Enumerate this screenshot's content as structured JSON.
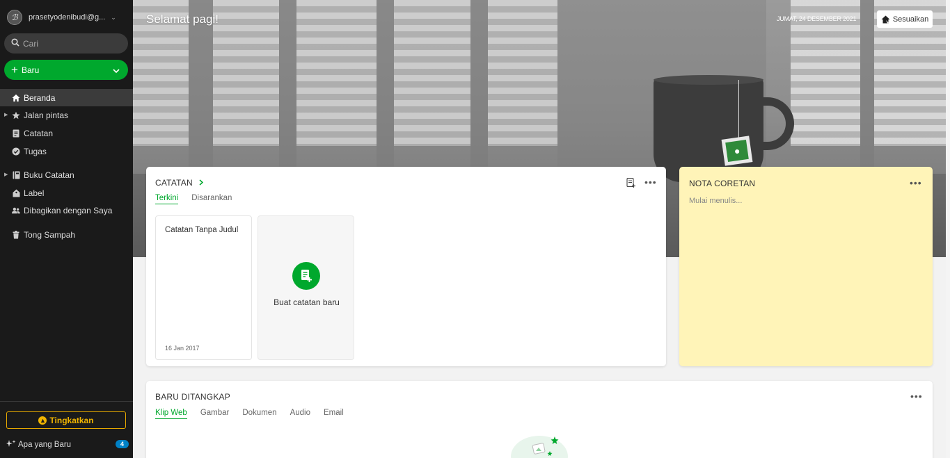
{
  "account": {
    "email": "prasetyodenibudi@g...",
    "avatar_letter": "ℬ"
  },
  "search": {
    "placeholder": "Cari"
  },
  "new_button": {
    "label": "Baru"
  },
  "nav": {
    "home": "Beranda",
    "shortcuts": "Jalan pintas",
    "notes": "Catatan",
    "tasks": "Tugas",
    "notebooks": "Buku Catatan",
    "tags": "Label",
    "shared": "Dibagikan dengan Saya",
    "trash": "Tong Sampah"
  },
  "upgrade": {
    "label": "Tingkatkan"
  },
  "whats_new": {
    "label": "Apa yang Baru",
    "count": "4"
  },
  "hero": {
    "greeting": "Selamat pagi!",
    "date": "JUMAT, 24 DESEMBER 2021",
    "customize_label": "Sesuaikan"
  },
  "notes_widget": {
    "title": "CATATAN",
    "tabs": [
      "Terkini",
      "Disarankan"
    ],
    "items": [
      {
        "title": "Catatan Tanpa Judul",
        "date": "16 Jan 2017"
      }
    ],
    "new_note_label": "Buat catatan baru"
  },
  "scratch_pad": {
    "title": "NOTA CORETAN",
    "placeholder": "Mulai menulis..."
  },
  "captured_widget": {
    "title": "BARU DITANGKAP",
    "tabs": [
      "Klip Web",
      "Gambar",
      "Dokumen",
      "Audio",
      "Email"
    ]
  },
  "colors": {
    "accent_green": "#00a82d",
    "sidebar_bg": "#1a1a1a",
    "upgrade_gold": "#f0b400",
    "badge_blue": "#0081c6",
    "scratch_yellow": "#fff4b8"
  },
  "icons": [
    "chevron-down-icon",
    "search-icon",
    "plus-icon",
    "home-icon",
    "star-icon",
    "note-icon",
    "check-circle-icon",
    "notebook-icon",
    "tag-icon",
    "shared-users-icon",
    "trash-icon",
    "coin-icon",
    "sparkle-icon",
    "home-customize-icon",
    "new-note-icon",
    "more-dots-icon",
    "arrow-right-icon"
  ]
}
